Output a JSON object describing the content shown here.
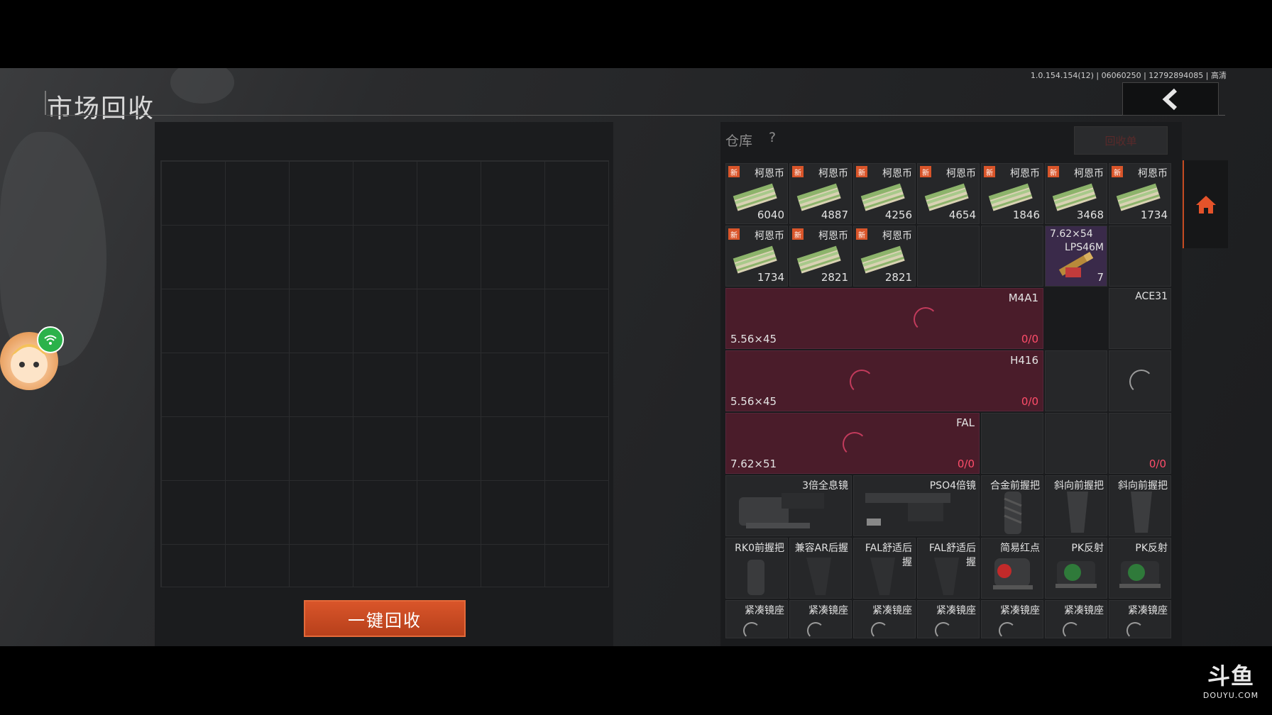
{
  "header": {
    "title": "市场回收",
    "version": "1.0.154.154(12) | 06060250 | 12792894085 | 高清"
  },
  "recycle": {
    "onekey_label": "一键回收"
  },
  "warehouse": {
    "label": "仓库",
    "help": "?",
    "button_label": "回收单"
  },
  "currency": [
    {
      "name": "柯恩币",
      "count": "6040",
      "new": "新"
    },
    {
      "name": "柯恩币",
      "count": "4887",
      "new": "新"
    },
    {
      "name": "柯恩币",
      "count": "4256",
      "new": "新"
    },
    {
      "name": "柯恩币",
      "count": "4654",
      "new": "新"
    },
    {
      "name": "柯恩币",
      "count": "1846",
      "new": "新"
    },
    {
      "name": "柯恩币",
      "count": "3468",
      "new": "新"
    },
    {
      "name": "柯恩币",
      "count": "1734",
      "new": "新"
    },
    {
      "name": "柯恩币",
      "count": "1734",
      "new": "新"
    },
    {
      "name": "柯恩币",
      "count": "2821",
      "new": "新"
    },
    {
      "name": "柯恩币",
      "count": "2821",
      "new": "新"
    }
  ],
  "ammo": {
    "name": "7.62×54",
    "sub": "LPS46M",
    "count": "7"
  },
  "weapons": {
    "m4a1": {
      "name": "M4A1",
      "caliber": "5.56×45",
      "count": "0/0"
    },
    "ace31": {
      "name": "ACE31",
      "count": "0/0"
    },
    "h416": {
      "name": "H416",
      "caliber": "5.56×45",
      "count": "0/0"
    },
    "fal": {
      "name": "FAL",
      "caliber": "7.62×51",
      "count": "0/0"
    }
  },
  "accessories_row1": [
    {
      "name": "3倍全息镜"
    },
    {
      "name": "PSO4倍镜"
    },
    {
      "name": "合金前握把"
    },
    {
      "name": "斜向前握把"
    },
    {
      "name": "斜向前握把"
    }
  ],
  "accessories_row2": [
    {
      "name": "RK0前握把"
    },
    {
      "name": "兼容AR后握"
    },
    {
      "name": "FAL舒适后握"
    },
    {
      "name": "FAL舒适后握"
    },
    {
      "name": "简易红点"
    },
    {
      "name": "PK反射"
    },
    {
      "name": "PK反射"
    }
  ],
  "accessories_row3": [
    {
      "name": "紧凑镜座"
    },
    {
      "name": "紧凑镜座"
    },
    {
      "name": "紧凑镜座"
    },
    {
      "name": "紧凑镜座"
    },
    {
      "name": "紧凑镜座"
    },
    {
      "name": "紧凑镜座"
    },
    {
      "name": "紧凑镜座"
    }
  ],
  "watermark": {
    "main": "斗鱼",
    "sub": "DOUYU.COM"
  },
  "colors": {
    "accent": "#d9552a",
    "weapon_bg": "#4a1c2a",
    "count_red": "#ff4d6a"
  }
}
